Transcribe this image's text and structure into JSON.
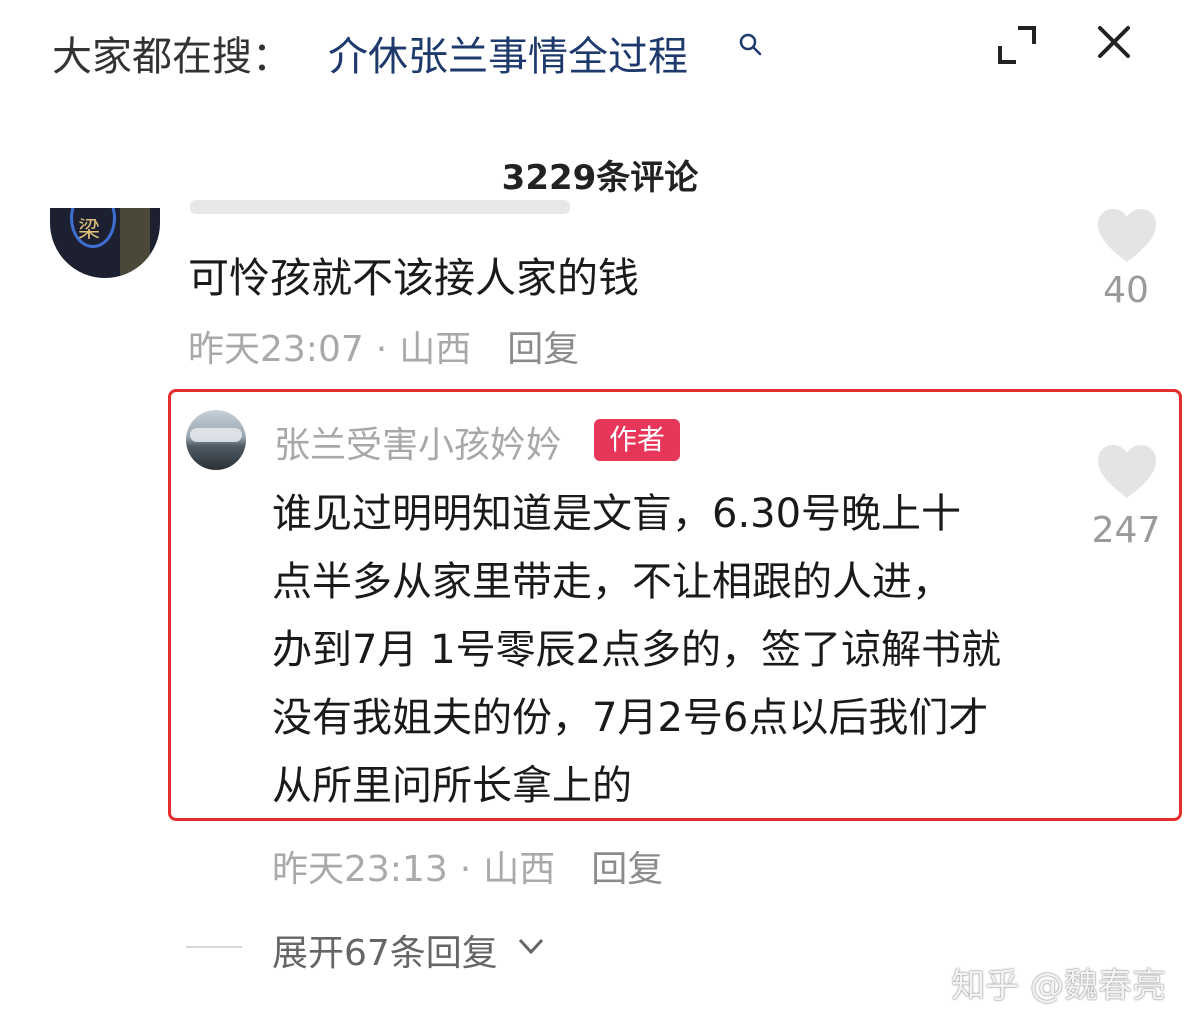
{
  "topbar": {
    "search_prefix": "大家都在搜：",
    "search_query": "介休张兰事情全过程",
    "search_icon": "search-icon",
    "expand_icon": "expand-icon",
    "close_icon": "close-icon"
  },
  "comments_header": {
    "count_label": "3229条评论"
  },
  "comment1": {
    "text": "可怜孩就不该接人家的钱",
    "time": "昨天23:07",
    "separator": "·",
    "location": "山西",
    "reply_label": "回复",
    "like_count": "40"
  },
  "reply1": {
    "username": "张兰受害小孩妗妗",
    "badge": "作者",
    "lines": [
      "谁见过明明知道是文盲，6.30号晚上十",
      "点半多从家里带走，不让相跟的人进，",
      "办到7月 1号零辰2点多的，签了谅解书就",
      "没有我姐夫的份，7月2号6点以后我们才",
      "从所里问所长拿上的"
    ],
    "time": "昨天23:13",
    "separator": "·",
    "location": "山西",
    "reply_label": "回复",
    "like_count": "247"
  },
  "expand": {
    "label": "展开67条回复"
  },
  "watermark": {
    "text": "知乎 @魏春亮"
  },
  "colors": {
    "highlight_border": "#e52d2d",
    "author_badge": "#e8365a",
    "search_query": "#1e3a6d"
  }
}
